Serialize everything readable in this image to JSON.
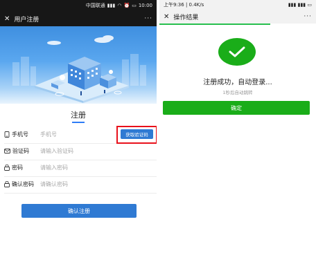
{
  "left": {
    "statusbar": {
      "carrier": "中国联通",
      "time": "10:00"
    },
    "header": {
      "title": "用户注册",
      "more": "···"
    },
    "form": {
      "title": "注册",
      "rows": [
        {
          "label": "手机号",
          "placeholder": "手机号",
          "icon": "phone-icon"
        },
        {
          "label": "验证码",
          "placeholder": "请输入验证码",
          "icon": "message-icon"
        },
        {
          "label": "密码",
          "placeholder": "请输入密码",
          "icon": "lock-icon"
        },
        {
          "label": "确认密码",
          "placeholder": "请确认密码",
          "icon": "lock-icon"
        }
      ],
      "get_code_label": "获取验证码",
      "submit_label": "确认注册"
    },
    "colors": {
      "primary": "#2f7ad3",
      "highlight": "#e8101a"
    }
  },
  "right": {
    "statusbar": {
      "left": "上午9:36 | 0.4K/s"
    },
    "header": {
      "title": "操作结果",
      "more": "···"
    },
    "result": {
      "title": "注册成功，自动登录...",
      "subtitle": "1秒后自动跳转",
      "confirm_label": "确定"
    },
    "colors": {
      "success": "#1aad19"
    }
  }
}
